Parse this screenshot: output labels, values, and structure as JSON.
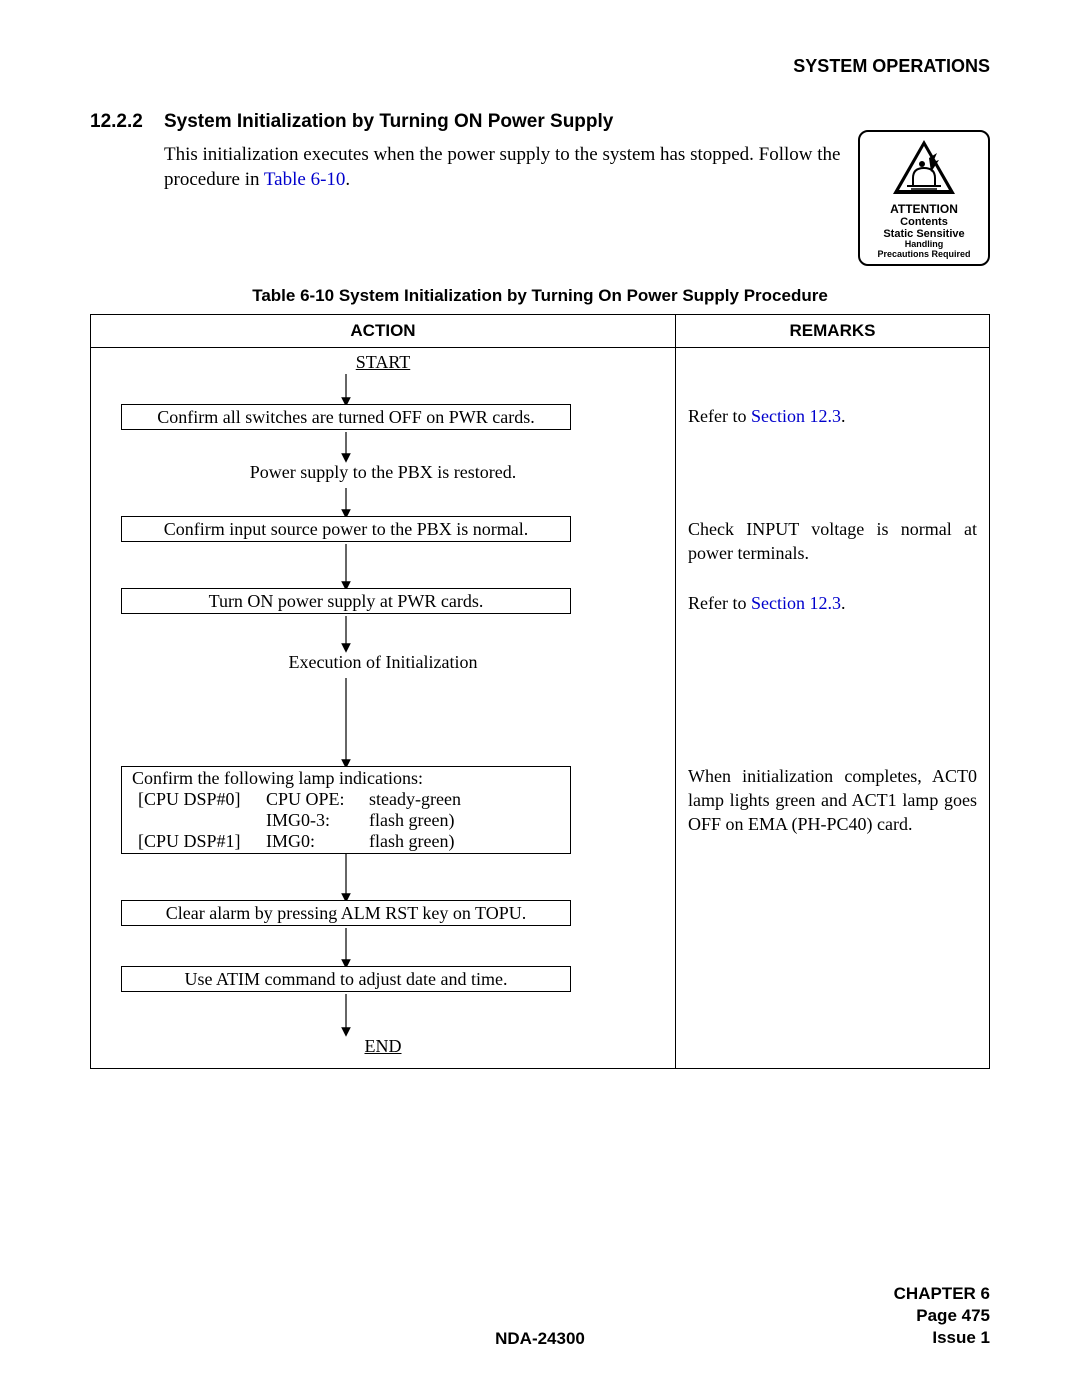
{
  "header": {
    "running": "SYSTEM OPERATIONS"
  },
  "section": {
    "number": "12.2.2",
    "title": "System Initialization by Turning ON Power Supply"
  },
  "intro_prefix": "This initialization executes when the power supply to the system has stopped. Follow the procedure in ",
  "intro_link": "Table 6-10",
  "intro_suffix": ".",
  "caution": {
    "attention": "ATTENTION",
    "line1": "Contents",
    "line2": "Static Sensitive",
    "small1": "Handling",
    "small2": "Precautions Required"
  },
  "table": {
    "caption": "Table 6-10  System Initialization by Turning On Power Supply Procedure",
    "head_action": "ACTION",
    "head_remarks": "REMARKS"
  },
  "flow": {
    "start": "START",
    "end": "END",
    "step1": "Confirm all switches are turned OFF on PWR cards.",
    "step2": "Power supply to the PBX is restored.",
    "step3": "Confirm input source power to the PBX is normal.",
    "step4": "Turn ON power supply at PWR cards.",
    "step5": "Execution of Initialization",
    "step6_intro": "Confirm the following lamp indications:",
    "step6_r1c1": "[CPU DSP#0]",
    "step6_r1c2": "CPU OPE:",
    "step6_r1c3": "steady-green",
    "step6_r2c1": "",
    "step6_r2c2": "IMG0-3:",
    "step6_r2c3": "flash green)",
    "step6_r3c1": "[CPU DSP#1]",
    "step6_r3c2": "IMG0:",
    "step6_r3c3": "flash green)",
    "step7": "Clear alarm by pressing ALM RST key on TOPU.",
    "step8": "Use ATIM command to adjust date and time."
  },
  "remarks": {
    "r1_prefix": "Refer to ",
    "r1_link": "Section 12.3",
    "r1_suffix": ".",
    "r3": "Check INPUT voltage is normal at power terminals.",
    "r4_prefix": "Refer to ",
    "r4_link": "Section 12.3",
    "r4_suffix": ".",
    "r6": "When initialization completes, ACT0 lamp lights green and ACT1 lamp goes OFF on EMA (PH-PC40) card."
  },
  "footer": {
    "doc": "NDA-24300",
    "chapter": "CHAPTER 6",
    "page": "Page 475",
    "issue": "Issue 1"
  }
}
